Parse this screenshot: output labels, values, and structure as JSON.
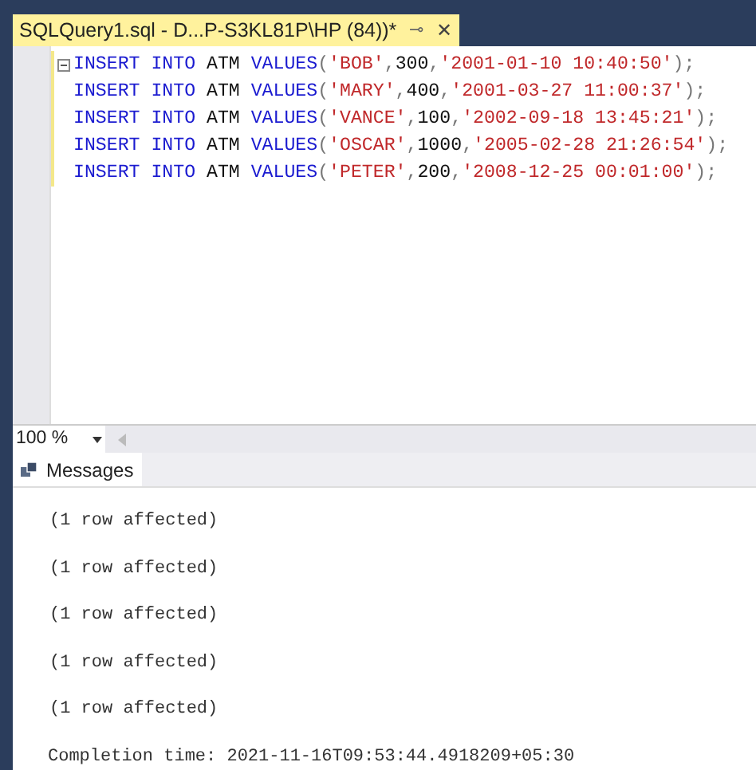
{
  "tab": {
    "title": "SQLQuery1.sql - D...P-S3KL81P\\HP (84))*",
    "pin": "⊸",
    "close": "✕"
  },
  "editor": {
    "lines": [
      {
        "tokens": [
          {
            "kind": "keyword",
            "text": "INSERT INTO"
          },
          {
            "kind": "plain",
            "text": " ATM "
          },
          {
            "kind": "keyword",
            "text": "VALUES"
          },
          {
            "kind": "punct",
            "text": "("
          },
          {
            "kind": "string",
            "text": "'BOB'"
          },
          {
            "kind": "punct",
            "text": ","
          },
          {
            "kind": "plain",
            "text": "300"
          },
          {
            "kind": "punct",
            "text": ","
          },
          {
            "kind": "string",
            "text": "'2001-01-10 10:40:50'"
          },
          {
            "kind": "punct",
            "text": ");"
          }
        ]
      },
      {
        "tokens": [
          {
            "kind": "keyword",
            "text": "INSERT INTO"
          },
          {
            "kind": "plain",
            "text": " ATM "
          },
          {
            "kind": "keyword",
            "text": "VALUES"
          },
          {
            "kind": "punct",
            "text": "("
          },
          {
            "kind": "string",
            "text": "'MARY'"
          },
          {
            "kind": "punct",
            "text": ","
          },
          {
            "kind": "plain",
            "text": "400"
          },
          {
            "kind": "punct",
            "text": ","
          },
          {
            "kind": "string",
            "text": "'2001-03-27 11:00:37'"
          },
          {
            "kind": "punct",
            "text": ");"
          }
        ]
      },
      {
        "tokens": [
          {
            "kind": "keyword",
            "text": "INSERT INTO"
          },
          {
            "kind": "plain",
            "text": " ATM "
          },
          {
            "kind": "keyword",
            "text": "VALUES"
          },
          {
            "kind": "punct",
            "text": "("
          },
          {
            "kind": "string",
            "text": "'VANCE'"
          },
          {
            "kind": "punct",
            "text": ","
          },
          {
            "kind": "plain",
            "text": "100"
          },
          {
            "kind": "punct",
            "text": ","
          },
          {
            "kind": "string",
            "text": "'2002-09-18 13:45:21'"
          },
          {
            "kind": "punct",
            "text": ");"
          }
        ]
      },
      {
        "tokens": [
          {
            "kind": "keyword",
            "text": "INSERT INTO"
          },
          {
            "kind": "plain",
            "text": " ATM "
          },
          {
            "kind": "keyword",
            "text": "VALUES"
          },
          {
            "kind": "punct",
            "text": "("
          },
          {
            "kind": "string",
            "text": "'OSCAR'"
          },
          {
            "kind": "punct",
            "text": ","
          },
          {
            "kind": "plain",
            "text": "1000"
          },
          {
            "kind": "punct",
            "text": ","
          },
          {
            "kind": "string",
            "text": "'2005-02-28 21:26:54'"
          },
          {
            "kind": "punct",
            "text": ");"
          }
        ]
      },
      {
        "tokens": [
          {
            "kind": "keyword",
            "text": "INSERT INTO"
          },
          {
            "kind": "plain",
            "text": " ATM "
          },
          {
            "kind": "keyword",
            "text": "VALUES"
          },
          {
            "kind": "punct",
            "text": "("
          },
          {
            "kind": "string",
            "text": "'PETER'"
          },
          {
            "kind": "punct",
            "text": ","
          },
          {
            "kind": "plain",
            "text": "200"
          },
          {
            "kind": "punct",
            "text": ","
          },
          {
            "kind": "string",
            "text": "'2008-12-25 00:01:00'"
          },
          {
            "kind": "punct",
            "text": ");"
          }
        ]
      }
    ]
  },
  "zoom": {
    "value": "100 %"
  },
  "results_tabs": [
    {
      "label": "Messages",
      "selected": true
    }
  ],
  "messages": [
    "(1 row affected)",
    "(1 row affected)",
    "(1 row affected)",
    "(1 row affected)",
    "(1 row affected)"
  ],
  "completion": "Completion time: 2021-11-16T09:53:44.4918209+05:30"
}
